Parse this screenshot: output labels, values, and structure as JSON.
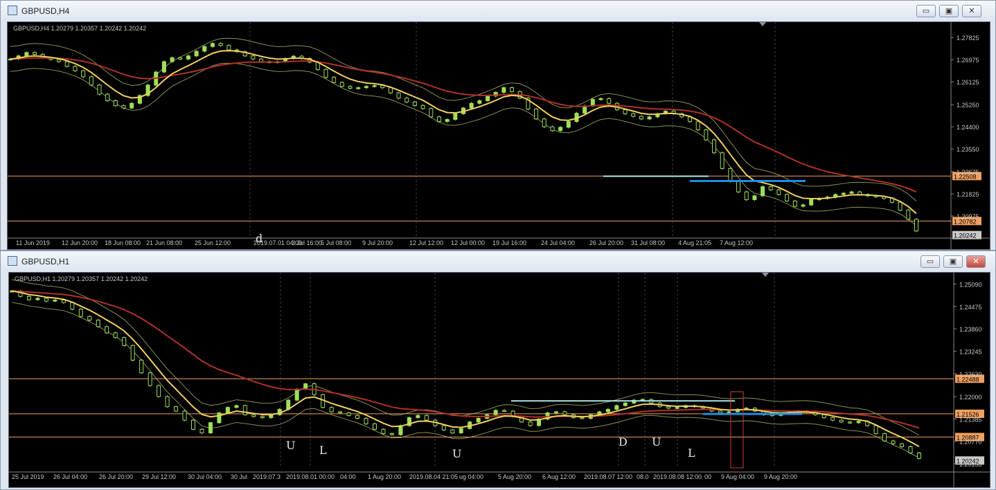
{
  "windows": [
    {
      "title": "GBPUSD,H4",
      "info": "GBPUSD,H4  1.20279 1.20357 1.20242 1.20242",
      "buttons": {
        "minimize": "▭",
        "maximize": "▣",
        "close": "✕"
      },
      "chart_data": {
        "type": "candlestick",
        "symbol": "GBPUSD",
        "timeframe": "H4",
        "ohlc_last": [
          1.20279,
          1.20357,
          1.20242,
          1.20242
        ],
        "ylim": [
          1.2018,
          1.2815
        ],
        "y_ticks": [
          "1.27825",
          "1.26975",
          "1.26125",
          "1.25250",
          "1.24400",
          "1.23550",
          "1.22675",
          "1.21825",
          "1.20975"
        ],
        "x_ticks": [
          "11 Jun 2019",
          "12 Jun 20:00",
          "18 Jun 08:00",
          "21 Jun 08:00",
          "25 Jun 12:00",
          "2019.07.01 04:00",
          "3 Jul 16:00",
          "5 Jul 08:00",
          "9 Jul 20:00",
          "12 Jul 12:00",
          "12 Jul 00:00",
          "19 Jul 16:00",
          "24 Jul 04:00",
          "26 Jul 20:00",
          "31 Jul 08:00",
          "4 Aug 21:05",
          "7 Aug 12:00"
        ],
        "price_lines": [
          {
            "label": "1.22508",
            "value": 1.22508,
            "color": "#f0a060"
          },
          {
            "label": "1.20782",
            "value": 1.20782,
            "color": "#f0a060"
          }
        ],
        "current_price_label": "1.20242",
        "annotations": [
          "d"
        ],
        "series_close": [
          1.27,
          1.2712,
          1.2725,
          1.2718,
          1.2705,
          1.2698,
          1.269,
          1.2672,
          1.2655,
          1.2632,
          1.26,
          1.2565,
          1.254,
          1.2521,
          1.2512,
          1.253,
          1.256,
          1.26,
          1.265,
          1.269,
          1.2705,
          1.27,
          1.2712,
          1.273,
          1.2748,
          1.276,
          1.2752,
          1.2735,
          1.2728,
          1.2712,
          1.27,
          1.269,
          1.2688,
          1.269,
          1.2702,
          1.2711,
          1.2702,
          1.2688,
          1.266,
          1.263,
          1.261,
          1.2595,
          1.2588,
          1.259,
          1.2595,
          1.2598,
          1.259,
          1.257,
          1.255,
          1.2535,
          1.2522,
          1.251,
          1.2478,
          1.246,
          1.2468,
          1.249,
          1.2512,
          1.253,
          1.254,
          1.2558,
          1.2572,
          1.259,
          1.2575,
          1.255,
          1.2508,
          1.247,
          1.244,
          1.2425,
          1.2438,
          1.246,
          1.2492,
          1.252,
          1.2545,
          1.2548,
          1.253,
          1.2505,
          1.249,
          1.248,
          1.247,
          1.2478,
          1.249,
          1.25,
          1.249,
          1.2478,
          1.246,
          1.2428,
          1.239,
          1.234,
          1.228,
          1.223,
          1.219,
          1.216,
          1.2175,
          1.221,
          1.2198,
          1.218,
          1.2155,
          1.2135,
          1.214,
          1.216,
          1.2165,
          1.217,
          1.218,
          1.2185,
          1.219,
          1.218,
          1.2175,
          1.2172,
          1.2165,
          1.215,
          1.212,
          1.2085,
          1.204
        ],
        "indicators": {
          "ema_fast": {
            "color": "#f2d060"
          },
          "ema_slow": {
            "color": "#b03228"
          },
          "bollinger": {
            "color": "#8e8e52"
          },
          "level_line_blue": {
            "value": 1.2232,
            "color": "#1a8fe6"
          },
          "level_line_cyan": {
            "value": 1.225,
            "color": "#a8e8e6"
          }
        }
      }
    },
    {
      "title": "GBPUSD,H1",
      "info": "GBPUSD,H1  1.20279 1.20357 1.20242 1.20242",
      "buttons": {
        "minimize": "▭",
        "maximize": "▣",
        "close": "✕"
      },
      "chart_data": {
        "type": "candlestick",
        "symbol": "GBPUSD",
        "timeframe": "H1",
        "ohlc_last": [
          1.20279,
          1.20357,
          1.20242,
          1.20242
        ],
        "ylim": [
          1.2004,
          1.2525
        ],
        "y_ticks": [
          "1.25090",
          "1.24475",
          "1.23860",
          "1.23245",
          "1.22630",
          "1.22000",
          "1.21385",
          "1.20770",
          "1.20155"
        ],
        "x_ticks": [
          "25 Jul 2019",
          "26 Jul 04:00",
          "26 Jul 20:00",
          "29 Jul 12:00",
          "30 Jul 04:00",
          "30 Jul",
          "2019.07.3",
          "2019.08.01 00:00",
          "04:00",
          "1 Aug 20:00",
          "2019.08.04 21:05",
          "ug 04:00",
          "5 Aug 20:00",
          "6 Aug 12:00",
          "2019.08.07 12:00",
          "08.0",
          "2019.08.08 12:00",
          "00",
          "9 Aug 04:00",
          "9 Aug 20:00"
        ],
        "price_lines": [
          {
            "label": "1.22488",
            "value": 1.22488,
            "color": "#f0a060"
          },
          {
            "label": "1.21526",
            "value": 1.21526,
            "color": "#f0a060"
          },
          {
            "label": "1.20887",
            "value": 1.20887,
            "color": "#f0a060"
          }
        ],
        "current_price_label": "1.20242",
        "annotations": [
          "U",
          "L",
          "U",
          "D",
          "U",
          "L"
        ],
        "series_close": [
          1.249,
          1.2475,
          1.2466,
          1.247,
          1.2462,
          1.2465,
          1.2458,
          1.244,
          1.242,
          1.241,
          1.2392,
          1.2375,
          1.2362,
          1.234,
          1.23,
          1.2265,
          1.223,
          1.22,
          1.2172,
          1.216,
          1.2135,
          1.211,
          1.21,
          1.2128,
          1.2155,
          1.217,
          1.2175,
          1.215,
          1.2145,
          1.2142,
          1.215,
          1.2165,
          1.219,
          1.222,
          1.2235,
          1.2205,
          1.217,
          1.2158,
          1.2155,
          1.2148,
          1.214,
          1.2125,
          1.211,
          1.2098,
          1.2095,
          1.212,
          1.2142,
          1.2148,
          1.2135,
          1.212,
          1.2108,
          1.21,
          1.2112,
          1.213,
          1.214,
          1.215,
          1.2162,
          1.216,
          1.2145,
          1.213,
          1.212,
          1.2138,
          1.2155,
          1.2158,
          1.215,
          1.2142,
          1.214,
          1.215,
          1.2158,
          1.2165,
          1.2175,
          1.2182,
          1.219,
          1.2192,
          1.2182,
          1.2172,
          1.2168,
          1.217,
          1.2175,
          1.2172,
          1.2168,
          1.216,
          1.2155,
          1.2158,
          1.2165,
          1.2168,
          1.216,
          1.215,
          1.2148,
          1.2152,
          1.2158,
          1.216,
          1.2158,
          1.215,
          1.2142,
          1.2135,
          1.213,
          1.2128,
          1.2132,
          1.212,
          1.2098,
          1.2078,
          1.207,
          1.2062,
          1.2045,
          1.203
        ],
        "indicators": {
          "ema_fast": {
            "color": "#f2d060"
          },
          "ema_slow": {
            "color": "#b03228"
          },
          "bollinger": {
            "color": "#8e8e52"
          },
          "level_line_blue": {
            "value": 1.2152,
            "color": "#1a8fe6"
          },
          "level_line_cyan": {
            "value": 1.2188,
            "color": "#a8e8e6"
          }
        }
      }
    }
  ]
}
